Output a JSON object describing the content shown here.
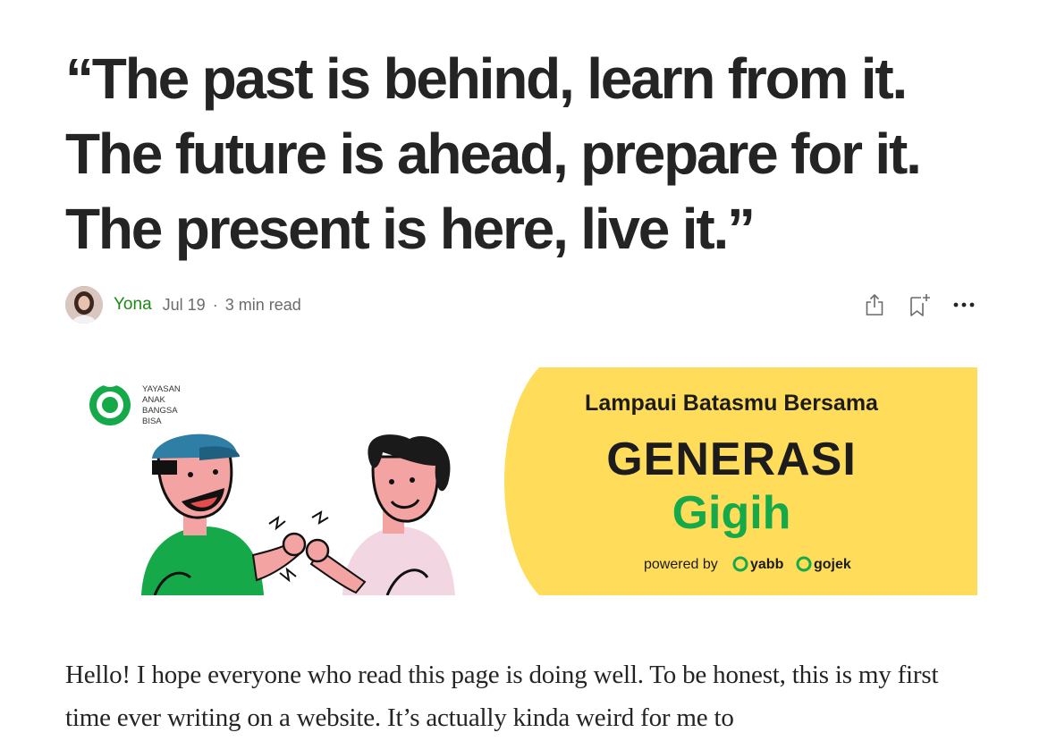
{
  "article": {
    "title": "“The past is behind, learn from it. The future is ahead, prepare for it. The present is here, live it.”",
    "author": "Yona",
    "date": "Jul 19",
    "read_time": "3 min read",
    "separator": "·",
    "body": "Hello! I hope everyone who read this page is doing well. To be honest, this is my first time ever writing on a website. It’s actually kinda weird for me to"
  },
  "actions": {
    "share": "share-icon",
    "save": "bookmark-add-icon",
    "more": "more-icon"
  },
  "hero": {
    "org_line1": "YAYASAN",
    "org_line2": "ANAK",
    "org_line3": "BANGSA",
    "org_line4": "BISA",
    "headline": "Lampaui Batasmu Bersama",
    "brand_word1": "GENERASI",
    "brand_word2": "Gigih",
    "powered_by": "powered by",
    "partner1": "yabb",
    "partner2": "gojek",
    "colors": {
      "yellow": "#FFDC5A",
      "green": "#16A94A",
      "dark": "#1C1C1C"
    }
  },
  "colors": {
    "author_green": "#1a8917",
    "text": "#242424",
    "meta": "#6b6b6b"
  }
}
